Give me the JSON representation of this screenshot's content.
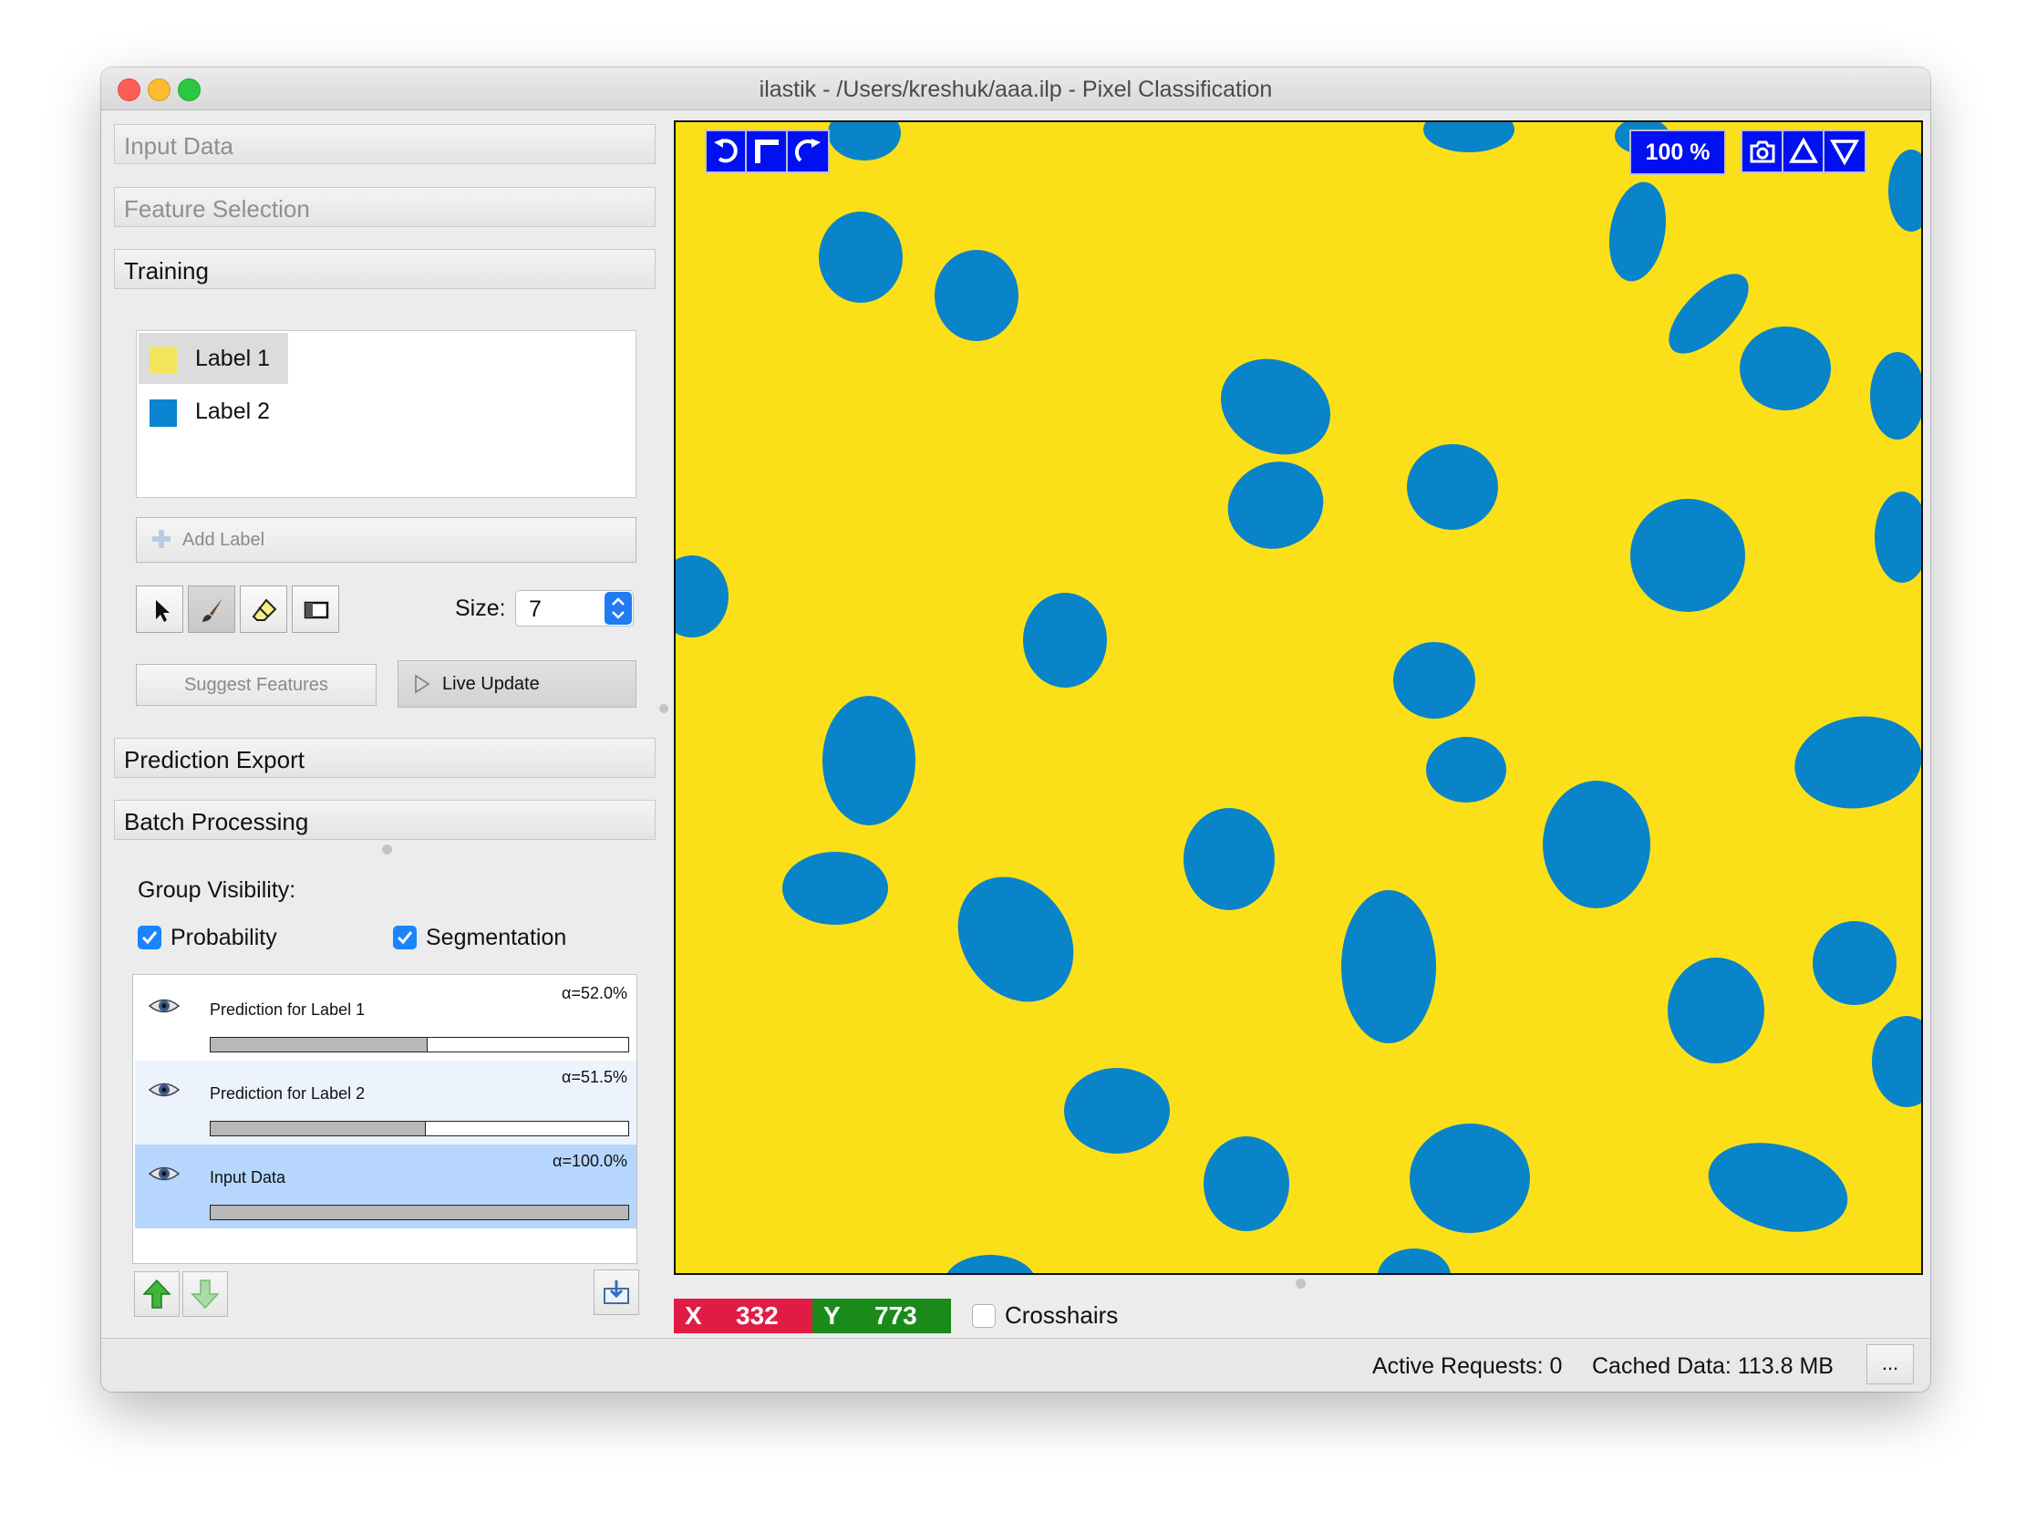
{
  "window": {
    "title": "ilastik - /Users/kreshuk/aaa.ilp - Pixel Classification"
  },
  "applets": {
    "input_data": "Input Data",
    "feature_selection": "Feature Selection",
    "training": "Training",
    "prediction_export": "Prediction Export",
    "batch_processing": "Batch Processing"
  },
  "labels": [
    {
      "name": "Label 1",
      "color": "#f3e55b"
    },
    {
      "name": "Label 2",
      "color": "#0a84d0"
    }
  ],
  "add_label": "Add Label",
  "tools": [
    "pointer-icon",
    "brush-icon",
    "eraser-icon",
    "rectangle-select-icon"
  ],
  "size": {
    "label": "Size:",
    "value": "7"
  },
  "buttons": {
    "suggest_features": "Suggest Features",
    "live_update": "Live Update"
  },
  "group_visibility": {
    "title": "Group Visibility:",
    "probability": "Probability",
    "segmentation": "Segmentation"
  },
  "layers": [
    {
      "name": "Prediction for Label 1",
      "alpha": "α=52.0%",
      "opacity": 0.52
    },
    {
      "name": "Prediction for Label 2",
      "alpha": "α=51.5%",
      "opacity": 0.515
    },
    {
      "name": "Input Data",
      "alpha": "α=100.0%",
      "opacity": 1.0
    }
  ],
  "viewer": {
    "zoom": "100 %",
    "background_color": "#fbe019",
    "blob_color": "#0a84c8"
  },
  "coords": {
    "x_label": "X",
    "x_value": "332",
    "y_label": "Y",
    "y_value": "773",
    "crosshairs": "Crosshairs"
  },
  "status": {
    "active_requests": "Active Requests: 0",
    "cached_data": "Cached Data: 113.8 MB",
    "more": "..."
  }
}
